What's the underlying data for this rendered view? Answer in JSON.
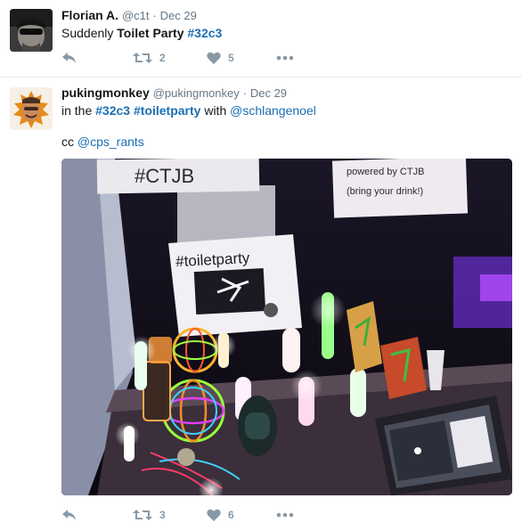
{
  "tweets": [
    {
      "display_name": "Florian A.",
      "handle": "@c1t",
      "sep": "·",
      "date": "Dec 29",
      "text": {
        "part1": "Suddenly ",
        "bold": "Toilet Party",
        "space": " ",
        "hashtag": "#32c3"
      },
      "retweet_count": "2",
      "like_count": "5"
    },
    {
      "display_name": "pukingmonkey",
      "handle": "@pukingmonkey",
      "sep": "·",
      "date": "Dec 29",
      "text": {
        "part1": "in the ",
        "hashtag1": "#32c3",
        "space": " ",
        "hashtag2": "#toiletparty",
        "part2": " with ",
        "mention": "@schlangenoel",
        "cc": "cc ",
        "mention2": "@cps_rants"
      },
      "photo_text": {
        "sign_left": "#CTJB",
        "sign_right_1": "powered by CTJB",
        "sign_right_2": "(bring your drink!)",
        "sign_center": "#toiletparty"
      },
      "retweet_count": "3",
      "like_count": "6"
    }
  ],
  "icons": {
    "reply": "reply-icon",
    "retweet": "retweet-icon",
    "like": "heart-icon",
    "more": "more-icon"
  },
  "colors": {
    "link": "#1b6fb3",
    "action_gray": "#8899a6",
    "meta_gray": "#657786",
    "divider": "#e6ecf0"
  }
}
